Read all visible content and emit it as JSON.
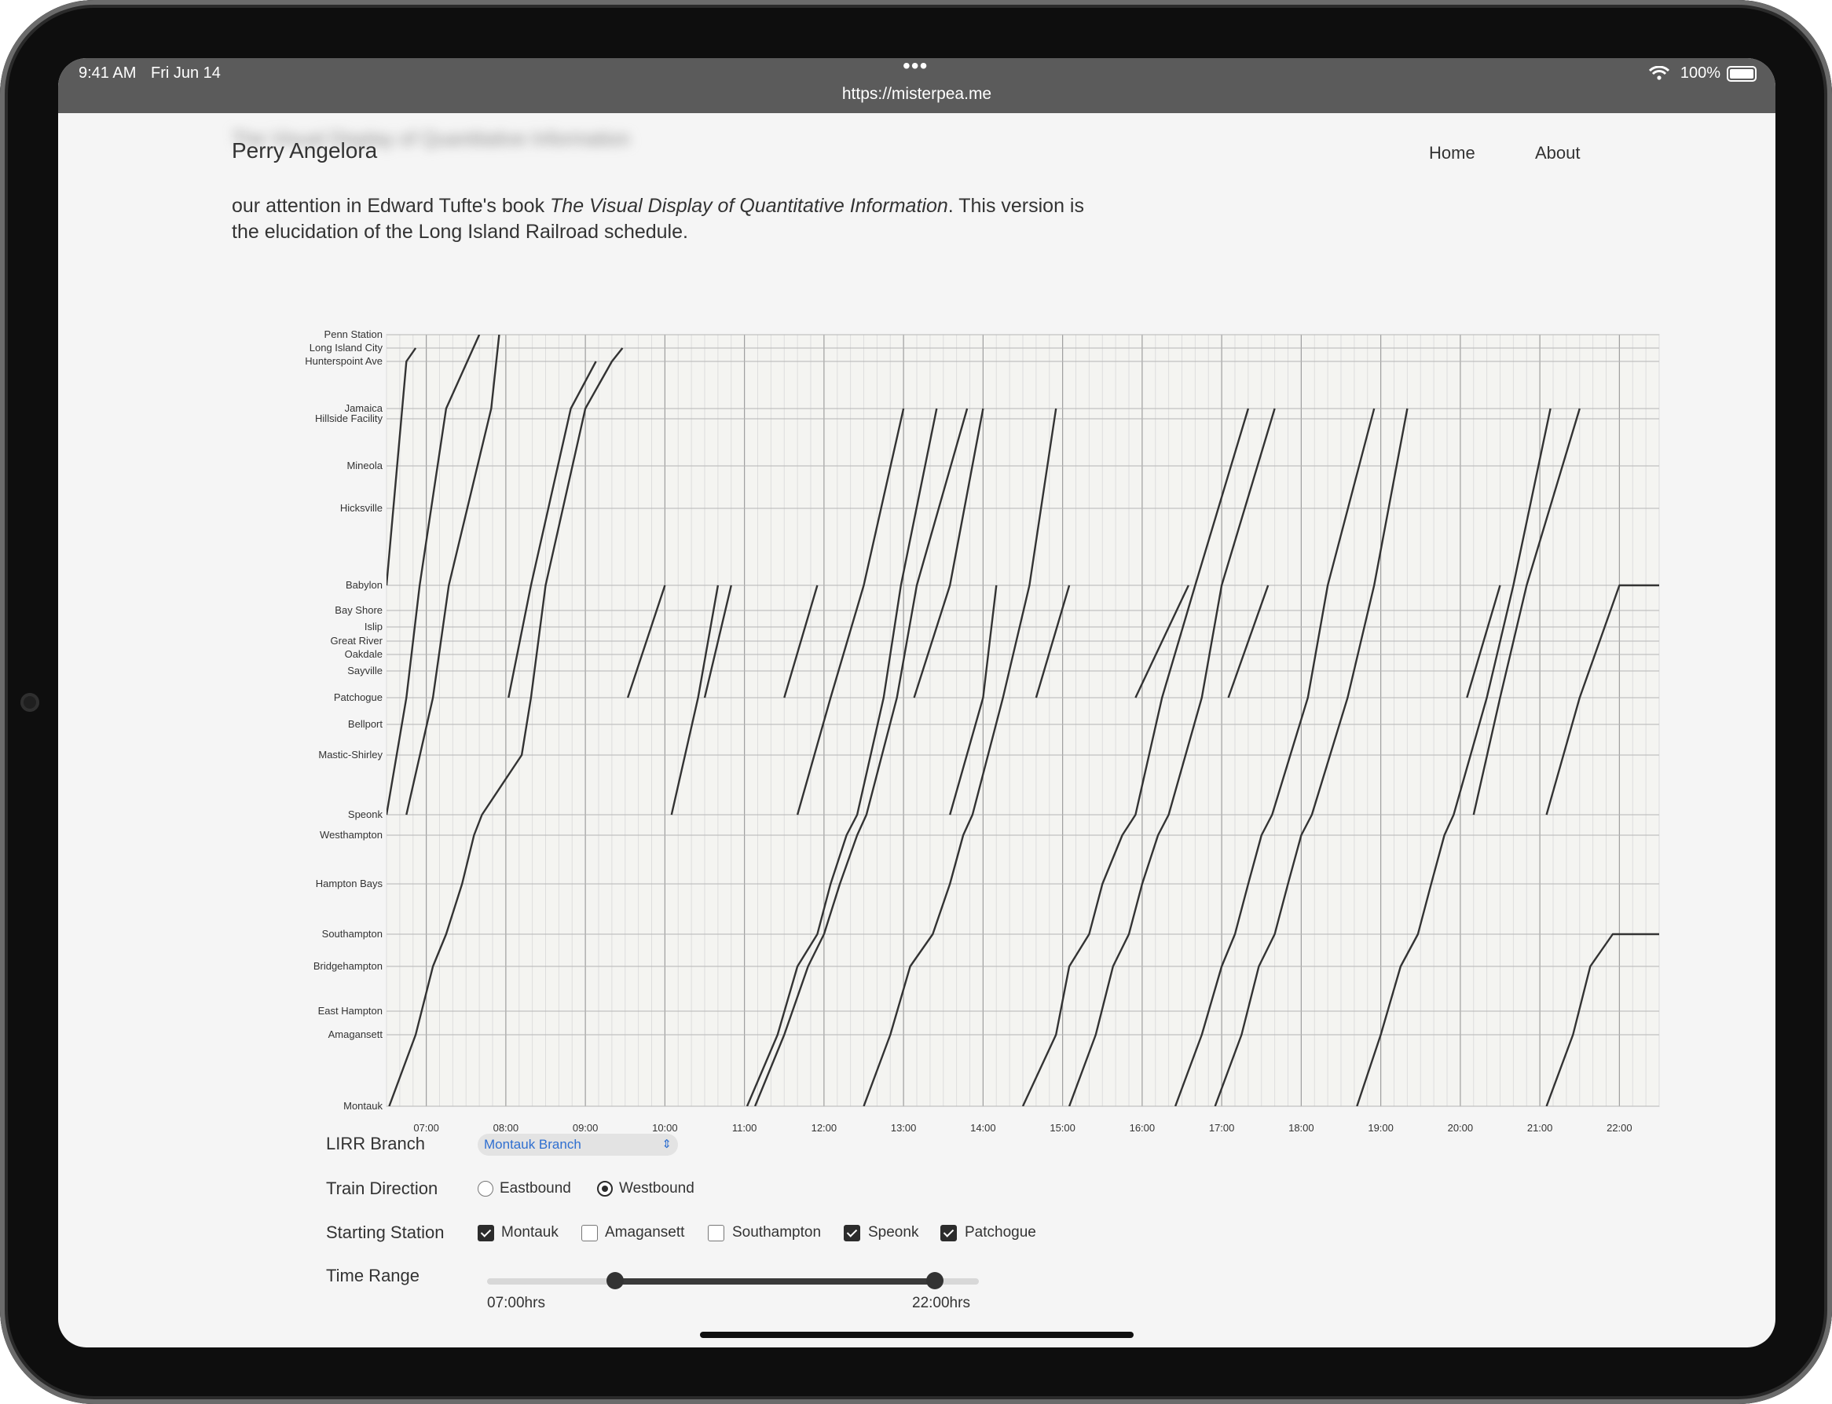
{
  "status_bar": {
    "time": "9:41 AM",
    "date": "Fri Jun 14",
    "url": "https://misterpea.me",
    "battery": "100%"
  },
  "site": {
    "title": "Perry Angelora",
    "nav": {
      "home": "Home",
      "about": "About"
    }
  },
  "intro": {
    "line_a": "our attention in Edward Tufte's book ",
    "book": "The Visual Display of Quantitative Information",
    "line_b": ". This version is the elucidation of the Long Island Railroad schedule."
  },
  "chart_data": {
    "type": "line",
    "title": "",
    "xlabel": "",
    "ylabel": "",
    "xlim": [
      "06:30",
      "22:30"
    ],
    "x_ticks": [
      "07:00",
      "08:00",
      "09:00",
      "10:00",
      "11:00",
      "12:00",
      "13:00",
      "14:00",
      "15:00",
      "16:00",
      "17:00",
      "18:00",
      "19:00",
      "20:00",
      "21:00",
      "22:00"
    ],
    "stations": [
      "Penn Station",
      "Long Island City",
      "Hunterspoint Ave",
      "Jamaica",
      "Hillside Facility",
      "Mineola",
      "Hicksville",
      "Babylon",
      "Bay Shore",
      "Islip",
      "Great River",
      "Oakdale",
      "Sayville",
      "Patchogue",
      "Bellport",
      "Mastic-Shirley",
      "Speonk",
      "Westhampton",
      "Hampton Bays",
      "Southampton",
      "Bridgehampton",
      "East Hampton",
      "Amagansett",
      "Montauk"
    ],
    "grid": true,
    "series": [
      {
        "start_station": "Montauk",
        "points": [
          [
            "06:32",
            "Montauk"
          ],
          [
            "06:52",
            "Amagansett"
          ],
          [
            "07:05",
            "Bridgehampton"
          ],
          [
            "07:15",
            "Southampton"
          ],
          [
            "07:27",
            "Hampton Bays"
          ],
          [
            "07:36",
            "Westhampton"
          ],
          [
            "07:42",
            "Speonk"
          ],
          [
            "08:12",
            "Mastic-Shirley"
          ],
          [
            "08:19",
            "Patchogue"
          ],
          [
            "08:30",
            "Babylon"
          ],
          [
            "09:00",
            "Jamaica"
          ],
          [
            "09:20",
            "Hunterspoint Ave"
          ],
          [
            "09:28",
            "Long Island City"
          ]
        ]
      },
      {
        "start_station": "Speonk",
        "points": [
          [
            "06:30",
            "Speonk"
          ],
          [
            "06:45",
            "Patchogue"
          ],
          [
            "06:55",
            "Babylon"
          ],
          [
            "07:15",
            "Jamaica"
          ],
          [
            "07:40",
            "Penn Station"
          ]
        ]
      },
      {
        "start_station": "Patchogue",
        "points": [
          [
            "06:30",
            "Babylon"
          ],
          [
            "06:45",
            "Hunterspoint Ave"
          ],
          [
            "06:52",
            "Long Island City"
          ]
        ]
      },
      {
        "start_station": "Speonk",
        "points": [
          [
            "06:45",
            "Speonk"
          ],
          [
            "07:05",
            "Patchogue"
          ],
          [
            "07:17",
            "Babylon"
          ],
          [
            "07:49",
            "Jamaica"
          ],
          [
            "07:55",
            "Penn Station"
          ]
        ]
      },
      {
        "start_station": "Patchogue",
        "points": [
          [
            "08:02",
            "Patchogue"
          ],
          [
            "08:19",
            "Babylon"
          ],
          [
            "08:49",
            "Jamaica"
          ],
          [
            "09:08",
            "Hunterspoint Ave"
          ]
        ]
      },
      {
        "start_station": "Patchogue",
        "points": [
          [
            "09:32",
            "Patchogue"
          ],
          [
            "10:00",
            "Babylon"
          ]
        ]
      },
      {
        "start_station": "Speonk",
        "points": [
          [
            "10:05",
            "Speonk"
          ],
          [
            "10:25",
            "Patchogue"
          ],
          [
            "10:40",
            "Babylon"
          ]
        ]
      },
      {
        "start_station": "Patchogue",
        "points": [
          [
            "10:30",
            "Patchogue"
          ],
          [
            "10:50",
            "Babylon"
          ]
        ]
      },
      {
        "start_station": "Patchogue",
        "points": [
          [
            "11:30",
            "Patchogue"
          ],
          [
            "11:55",
            "Babylon"
          ]
        ]
      },
      {
        "start_station": "Montauk",
        "points": [
          [
            "11:02",
            "Montauk"
          ],
          [
            "11:25",
            "Amagansett"
          ],
          [
            "11:40",
            "Bridgehampton"
          ],
          [
            "11:55",
            "Southampton"
          ],
          [
            "12:05",
            "Hampton Bays"
          ],
          [
            "12:17",
            "Westhampton"
          ],
          [
            "12:25",
            "Speonk"
          ],
          [
            "12:45",
            "Patchogue"
          ],
          [
            "12:58",
            "Babylon"
          ],
          [
            "13:25",
            "Jamaica"
          ]
        ]
      },
      {
        "start_station": "Montauk",
        "points": [
          [
            "11:08",
            "Montauk"
          ],
          [
            "11:30",
            "Amagansett"
          ],
          [
            "11:48",
            "Bridgehampton"
          ],
          [
            "12:00",
            "Southampton"
          ],
          [
            "12:12",
            "Hampton Bays"
          ],
          [
            "12:25",
            "Westhampton"
          ],
          [
            "12:32",
            "Speonk"
          ],
          [
            "12:55",
            "Patchogue"
          ],
          [
            "13:10",
            "Babylon"
          ],
          [
            "13:48",
            "Jamaica"
          ]
        ]
      },
      {
        "start_station": "Speonk",
        "points": [
          [
            "11:40",
            "Speonk"
          ],
          [
            "12:05",
            "Patchogue"
          ],
          [
            "12:30",
            "Babylon"
          ],
          [
            "13:00",
            "Jamaica"
          ]
        ]
      },
      {
        "start_station": "Montauk",
        "points": [
          [
            "12:30",
            "Montauk"
          ],
          [
            "12:50",
            "Amagansett"
          ],
          [
            "13:05",
            "Bridgehampton"
          ],
          [
            "13:22",
            "Southampton"
          ],
          [
            "13:35",
            "Hampton Bays"
          ],
          [
            "13:45",
            "Westhampton"
          ],
          [
            "13:52",
            "Speonk"
          ],
          [
            "14:15",
            "Patchogue"
          ],
          [
            "14:35",
            "Babylon"
          ],
          [
            "14:55",
            "Jamaica"
          ]
        ]
      },
      {
        "start_station": "Speonk",
        "points": [
          [
            "13:35",
            "Speonk"
          ],
          [
            "14:00",
            "Patchogue"
          ],
          [
            "14:10",
            "Babylon"
          ]
        ]
      },
      {
        "start_station": "Patchogue",
        "points": [
          [
            "13:08",
            "Patchogue"
          ],
          [
            "13:35",
            "Babylon"
          ],
          [
            "14:00",
            "Jamaica"
          ]
        ]
      },
      {
        "start_station": "Patchogue",
        "points": [
          [
            "14:40",
            "Patchogue"
          ],
          [
            "15:05",
            "Babylon"
          ]
        ]
      },
      {
        "start_station": "Montauk",
        "points": [
          [
            "14:30",
            "Montauk"
          ],
          [
            "14:55",
            "Amagansett"
          ],
          [
            "15:05",
            "Bridgehampton"
          ],
          [
            "15:20",
            "Southampton"
          ],
          [
            "15:30",
            "Hampton Bays"
          ],
          [
            "15:45",
            "Westhampton"
          ],
          [
            "15:55",
            "Speonk"
          ],
          [
            "16:15",
            "Patchogue"
          ],
          [
            "16:40",
            "Babylon"
          ],
          [
            "17:20",
            "Jamaica"
          ]
        ]
      },
      {
        "start_station": "Montauk",
        "points": [
          [
            "15:05",
            "Montauk"
          ],
          [
            "15:25",
            "Amagansett"
          ],
          [
            "15:38",
            "Bridgehampton"
          ],
          [
            "15:50",
            "Southampton"
          ],
          [
            "16:00",
            "Hampton Bays"
          ],
          [
            "16:12",
            "Westhampton"
          ],
          [
            "16:20",
            "Speonk"
          ],
          [
            "16:45",
            "Patchogue"
          ],
          [
            "17:00",
            "Babylon"
          ],
          [
            "17:40",
            "Jamaica"
          ]
        ]
      },
      {
        "start_station": "Patchogue",
        "points": [
          [
            "15:55",
            "Patchogue"
          ],
          [
            "16:35",
            "Babylon"
          ]
        ]
      },
      {
        "start_station": "Montauk",
        "points": [
          [
            "16:25",
            "Montauk"
          ],
          [
            "16:45",
            "Amagansett"
          ],
          [
            "17:00",
            "Bridgehampton"
          ],
          [
            "17:10",
            "Southampton"
          ],
          [
            "17:20",
            "Hampton Bays"
          ],
          [
            "17:30",
            "Westhampton"
          ],
          [
            "17:38",
            "Speonk"
          ],
          [
            "18:05",
            "Patchogue"
          ],
          [
            "18:20",
            "Babylon"
          ],
          [
            "18:55",
            "Jamaica"
          ]
        ]
      },
      {
        "start_station": "Montauk",
        "points": [
          [
            "16:55",
            "Montauk"
          ],
          [
            "17:15",
            "Amagansett"
          ],
          [
            "17:28",
            "Bridgehampton"
          ],
          [
            "17:40",
            "Southampton"
          ],
          [
            "17:50",
            "Hampton Bays"
          ],
          [
            "18:00",
            "Westhampton"
          ],
          [
            "18:08",
            "Speonk"
          ],
          [
            "18:35",
            "Patchogue"
          ],
          [
            "18:55",
            "Babylon"
          ],
          [
            "19:20",
            "Jamaica"
          ]
        ]
      },
      {
        "start_station": "Patchogue",
        "points": [
          [
            "17:05",
            "Patchogue"
          ],
          [
            "17:35",
            "Babylon"
          ]
        ]
      },
      {
        "start_station": "Montauk",
        "points": [
          [
            "18:42",
            "Montauk"
          ],
          [
            "19:00",
            "Amagansett"
          ],
          [
            "19:15",
            "Bridgehampton"
          ],
          [
            "19:28",
            "Southampton"
          ],
          [
            "19:38",
            "Hampton Bays"
          ],
          [
            "19:48",
            "Westhampton"
          ],
          [
            "19:55",
            "Speonk"
          ],
          [
            "20:20",
            "Patchogue"
          ],
          [
            "20:40",
            "Babylon"
          ],
          [
            "21:08",
            "Jamaica"
          ]
        ]
      },
      {
        "start_station": "Speonk",
        "points": [
          [
            "20:10",
            "Speonk"
          ],
          [
            "20:30",
            "Patchogue"
          ],
          [
            "20:50",
            "Babylon"
          ],
          [
            "21:30",
            "Jamaica"
          ]
        ]
      },
      {
        "start_station": "Patchogue",
        "points": [
          [
            "20:05",
            "Patchogue"
          ],
          [
            "20:30",
            "Babylon"
          ]
        ]
      },
      {
        "start_station": "Montauk",
        "points": [
          [
            "21:05",
            "Montauk"
          ],
          [
            "21:25",
            "Amagansett"
          ],
          [
            "21:38",
            "Bridgehampton"
          ],
          [
            "21:55",
            "Southampton"
          ],
          [
            "22:30",
            "Southampton"
          ]
        ]
      },
      {
        "start_station": "Speonk",
        "points": [
          [
            "21:05",
            "Speonk"
          ],
          [
            "21:30",
            "Patchogue"
          ],
          [
            "22:00",
            "Babylon"
          ],
          [
            "22:30",
            "Babylon"
          ]
        ]
      }
    ]
  },
  "controls": {
    "branch": {
      "label": "LIRR Branch",
      "value": "Montauk Branch"
    },
    "direction": {
      "label": "Train Direction",
      "options": [
        {
          "label": "Eastbound",
          "checked": false
        },
        {
          "label": "Westbound",
          "checked": true
        }
      ]
    },
    "starting_station": {
      "label": "Starting Station",
      "options": [
        {
          "label": "Montauk",
          "checked": true
        },
        {
          "label": "Amagansett",
          "checked": false
        },
        {
          "label": "Southampton",
          "checked": false
        },
        {
          "label": "Speonk",
          "checked": true
        },
        {
          "label": "Patchogue",
          "checked": true
        }
      ]
    },
    "time_range": {
      "label": "Time Range",
      "min_label": "07:00hrs",
      "max_label": "22:00hrs",
      "low_fraction": 0.26,
      "high_fraction": 0.91
    }
  }
}
